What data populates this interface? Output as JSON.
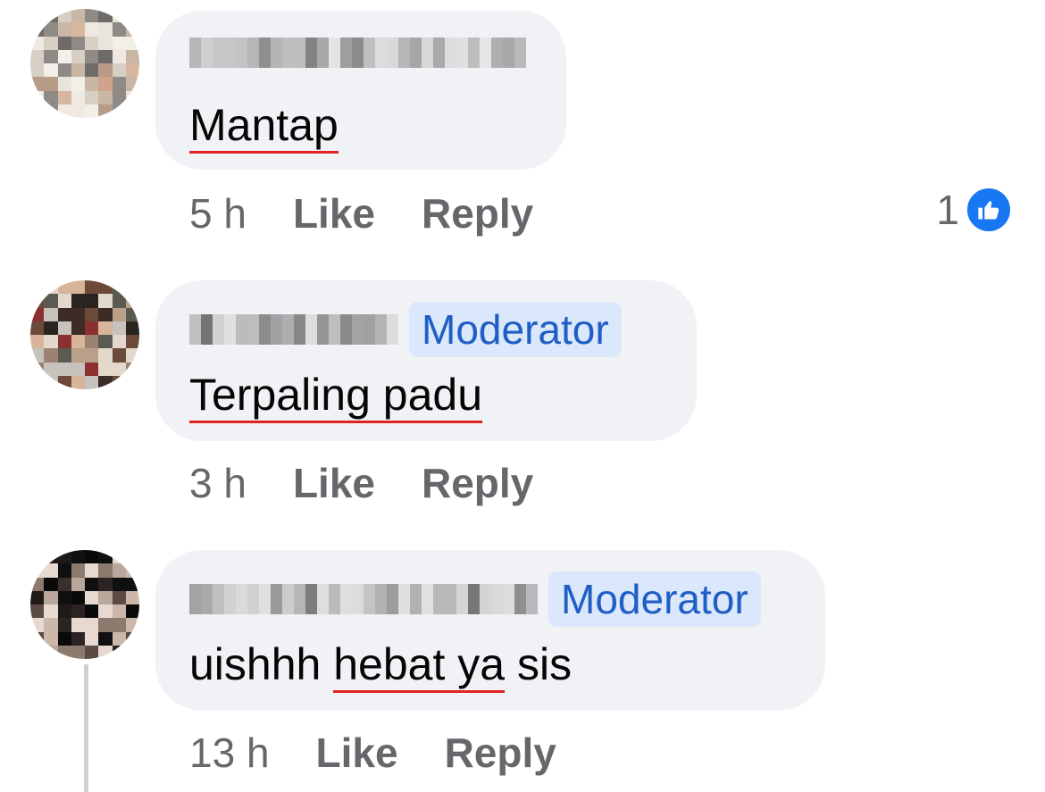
{
  "comments": [
    {
      "name_hidden": true,
      "badge": "",
      "text_before": "",
      "text_underlined": "Mantap",
      "text_after": "",
      "time": "5 h",
      "like_label": "Like",
      "reply_label": "Reply",
      "reaction_count": "1",
      "reaction_icon": "like-icon"
    },
    {
      "name_hidden": true,
      "badge": "Moderator",
      "text_before": "",
      "text_underlined": "Terpaling padu",
      "text_after": "",
      "time": "3 h",
      "like_label": "Like",
      "reply_label": "Reply"
    },
    {
      "name_hidden": true,
      "badge": "Moderator",
      "text_before": "uishhh ",
      "text_underlined": "hebat ya",
      "text_after": " sis",
      "time": "13 h",
      "like_label": "Like",
      "reply_label": "Reply"
    }
  ],
  "colors": {
    "bubble": "#f0f2f5",
    "badge_bg": "#dbe7fb",
    "badge_text": "#1f5ec4",
    "action_text": "#65676b",
    "like_blue": "#1877f2",
    "spell_underline": "#e02424"
  }
}
